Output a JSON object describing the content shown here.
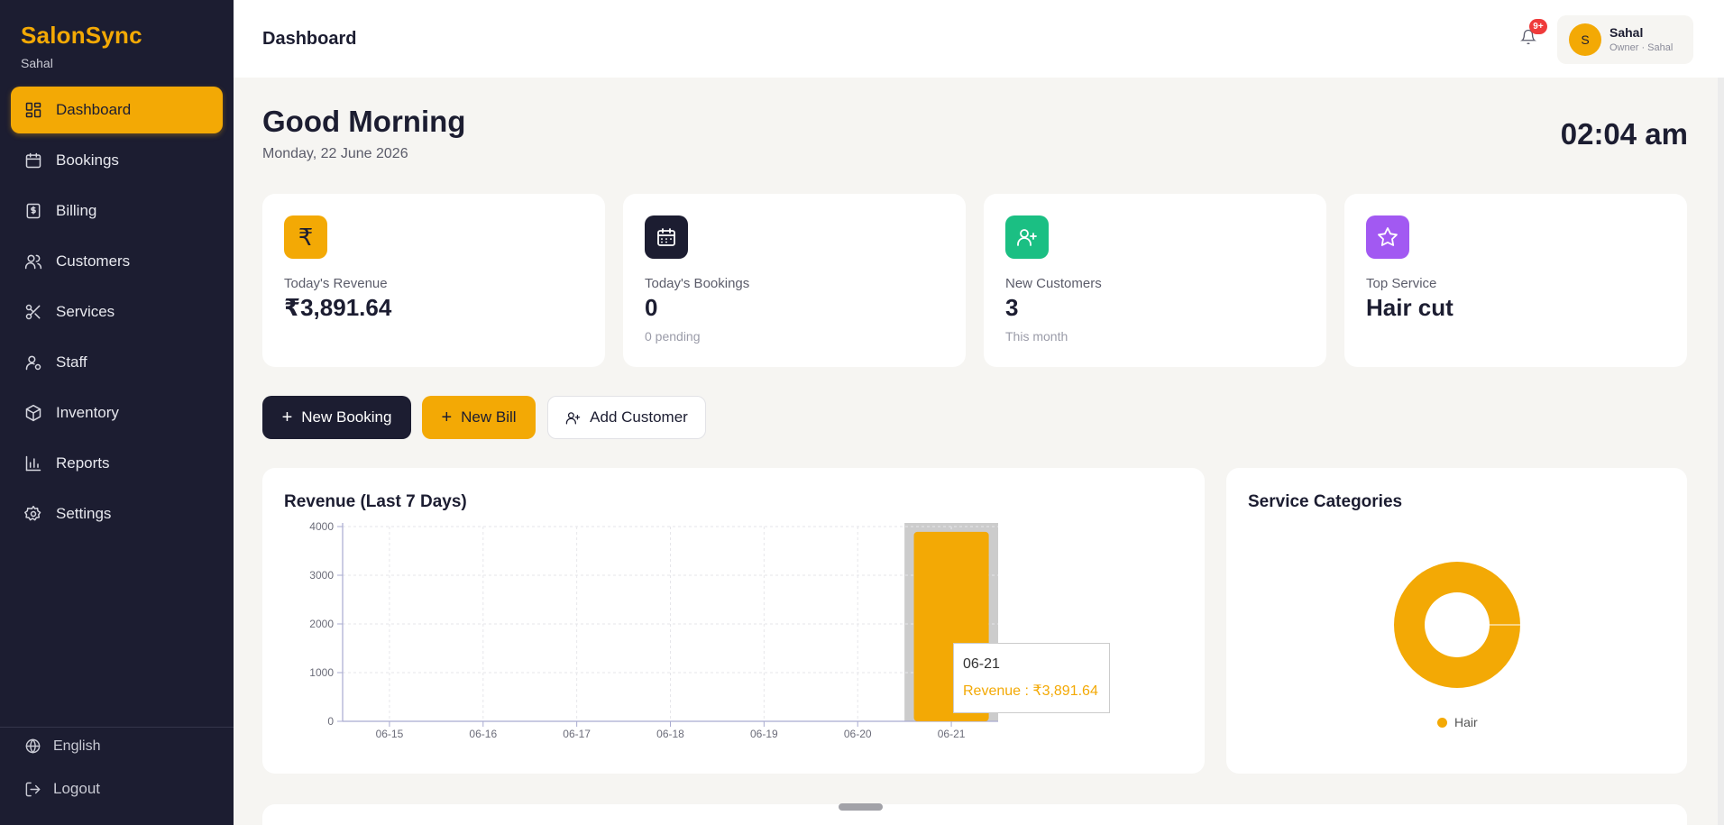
{
  "app": {
    "brand": "SalonSync",
    "subtitle": "Sahal"
  },
  "sidebar": {
    "items": [
      {
        "label": "Dashboard",
        "icon": "dashboard-icon"
      },
      {
        "label": "Bookings",
        "icon": "calendar-icon"
      },
      {
        "label": "Billing",
        "icon": "billing-icon"
      },
      {
        "label": "Customers",
        "icon": "users-icon"
      },
      {
        "label": "Services",
        "icon": "scissors-icon"
      },
      {
        "label": "Staff",
        "icon": "staff-icon"
      },
      {
        "label": "Inventory",
        "icon": "box-icon"
      },
      {
        "label": "Reports",
        "icon": "bar-chart-icon"
      },
      {
        "label": "Settings",
        "icon": "gear-icon"
      }
    ],
    "active_index": 0,
    "language": "English",
    "logout": "Logout"
  },
  "header": {
    "title": "Dashboard",
    "notification_badge": "9+",
    "user": {
      "initial": "S",
      "name": "Sahal",
      "role": "Owner · Sahal"
    }
  },
  "greeting": {
    "title": "Good Morning",
    "date": "Monday, 22 June 2026",
    "time": "02:04 am"
  },
  "stats": [
    {
      "label": "Today's Revenue",
      "value": "₹3,891.64",
      "sub": "",
      "icon": "rupee-icon",
      "color": "#f3a905"
    },
    {
      "label": "Today's Bookings",
      "value": "0",
      "sub": "0 pending",
      "icon": "calendar-icon",
      "color": "#1c1d31"
    },
    {
      "label": "New Customers",
      "value": "3",
      "sub": "This month",
      "icon": "user-plus-icon",
      "color": "#1bbf83"
    },
    {
      "label": "Top Service",
      "value": "Hair cut",
      "sub": "",
      "icon": "star-icon",
      "color": "#a259f2"
    }
  ],
  "actions": {
    "new_booking": "New Booking",
    "new_bill": "New Bill",
    "add_customer": "Add Customer"
  },
  "revenue_panel": {
    "title": "Revenue (Last 7 Days)",
    "tooltip": {
      "label": "06-21",
      "value": "Revenue : ₹3,891.64"
    }
  },
  "categories_panel": {
    "title": "Service Categories"
  },
  "colors": {
    "accent": "#f3a905",
    "sidebar_bg": "#1c1d31"
  },
  "chart_data": [
    {
      "type": "bar",
      "title": "Revenue (Last 7 Days)",
      "categories": [
        "06-15",
        "06-16",
        "06-17",
        "06-18",
        "06-19",
        "06-20",
        "06-21"
      ],
      "series": [
        {
          "name": "Revenue",
          "values": [
            0,
            0,
            0,
            0,
            0,
            0,
            3891.64
          ]
        }
      ],
      "yticks": [
        0,
        1000,
        2000,
        3000,
        4000
      ],
      "ylim": [
        0,
        4000
      ],
      "grid": true
    },
    {
      "type": "pie",
      "title": "Service Categories",
      "labels": [
        "Hair"
      ],
      "values": [
        100
      ],
      "legend": "bottom"
    }
  ]
}
